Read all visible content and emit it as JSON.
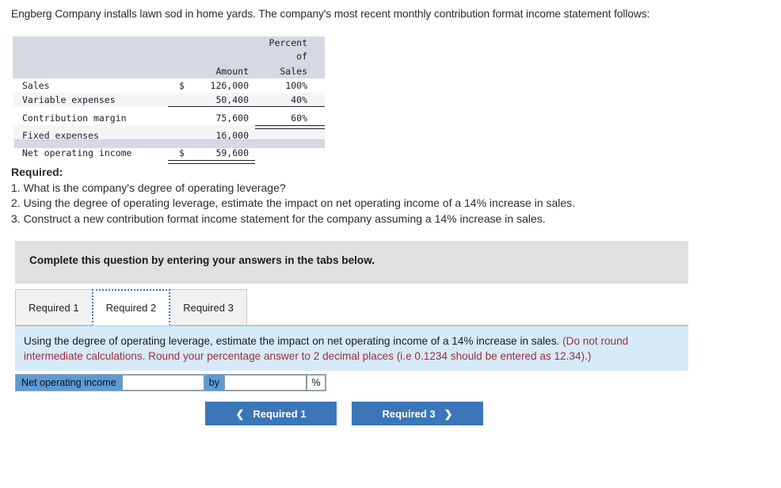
{
  "intro": {
    "text": "Engberg Company installs lawn sod in home yards. The company's most recent monthly contribution format income statement follows:"
  },
  "statement": {
    "headers": {
      "label": "",
      "amount": "Amount",
      "percent_line1": "Percent of",
      "percent_line2": "Sales"
    },
    "rows": [
      {
        "label": "Sales",
        "dollar": "$",
        "amount": "126,000",
        "percent": "100%"
      },
      {
        "label": "Variable expenses",
        "dollar": "",
        "amount": "50,400",
        "percent": "40%"
      },
      {
        "label": "Contribution margin",
        "dollar": "",
        "amount": "75,600",
        "percent": "60%"
      },
      {
        "label": "Fixed expenses",
        "dollar": "",
        "amount": "16,000",
        "percent": ""
      },
      {
        "label": "Net operating income",
        "dollar": "$",
        "amount": "59,600",
        "percent": ""
      }
    ]
  },
  "required": {
    "heading": "Required:",
    "items": [
      "1. What is the company's degree of operating leverage?",
      "2. Using the degree of operating leverage, estimate the impact on net operating income of a 14% increase in sales.",
      "3. Construct a new contribution format income statement for the company assuming a 14% increase in sales."
    ]
  },
  "instruction_bar": {
    "text": "Complete this question by entering your answers in the tabs below."
  },
  "tabs": [
    {
      "label": "Required 1",
      "active": false
    },
    {
      "label": "Required 2",
      "active": true
    },
    {
      "label": "Required 3",
      "active": false
    }
  ],
  "question_panel": {
    "main_text": "Using the degree of operating leverage, estimate the impact on net operating income of a 14% increase in sales. ",
    "note_text": "(Do not round intermediate calculations. Round your percentage answer to 2 decimal places (i.e 0.1234 should be entered as 12.34).)"
  },
  "answer_row": {
    "label": "Net operating income",
    "input_value": "",
    "input_placeholder": "",
    "connector": "by",
    "percent_value": "",
    "percent_placeholder": "",
    "percent_symbol": "%"
  },
  "navigation": {
    "prev_label": "Required 1",
    "prev_icon": "chevron-left",
    "next_label": "Required 3",
    "next_icon": "chevron-right"
  },
  "colors": {
    "table_header": "#d5d9e2",
    "instruction_bar": "#e0e0e0",
    "question_panel": "#d6eaf8",
    "note_red": "#a03038",
    "button_blue": "#3a76b8",
    "answer_label_blue": "#5b9bd5"
  }
}
